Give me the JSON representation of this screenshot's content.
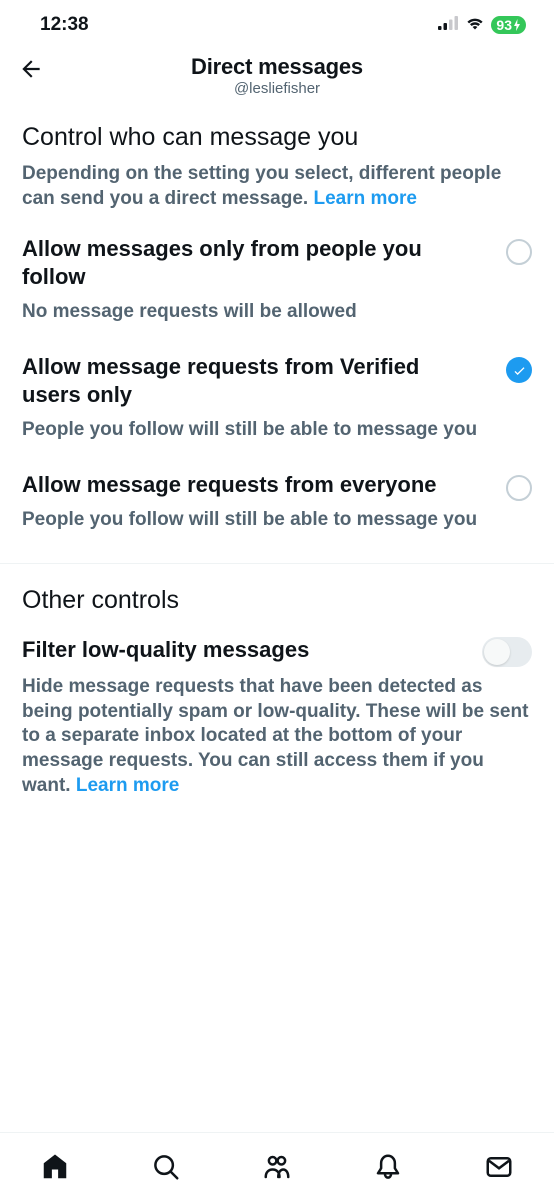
{
  "status_bar": {
    "time": "12:38",
    "battery": "93"
  },
  "header": {
    "title": "Direct messages",
    "subtitle": "@lesliefisher"
  },
  "section1": {
    "title": "Control who can message you",
    "description": "Depending on the setting you select, different people can send you a direct message.",
    "learn_more": "Learn more"
  },
  "options": [
    {
      "title": "Allow messages only from people you follow",
      "desc": "No message requests will be allowed",
      "selected": false
    },
    {
      "title": "Allow message requests from Verified users only",
      "desc": "People you follow will still be able to message you",
      "selected": true
    },
    {
      "title": "Allow message requests from everyone",
      "desc": "People you follow will still be able to message you",
      "selected": false
    }
  ],
  "section2": {
    "title": "Other controls"
  },
  "filter": {
    "title": "Filter low-quality messages",
    "desc": "Hide message requests that have been detected as being potentially spam or low-quality. These will be sent to a separate inbox located at the bottom of your message requests. You can still access them if you want.",
    "learn_more": "Learn more",
    "enabled": false
  }
}
